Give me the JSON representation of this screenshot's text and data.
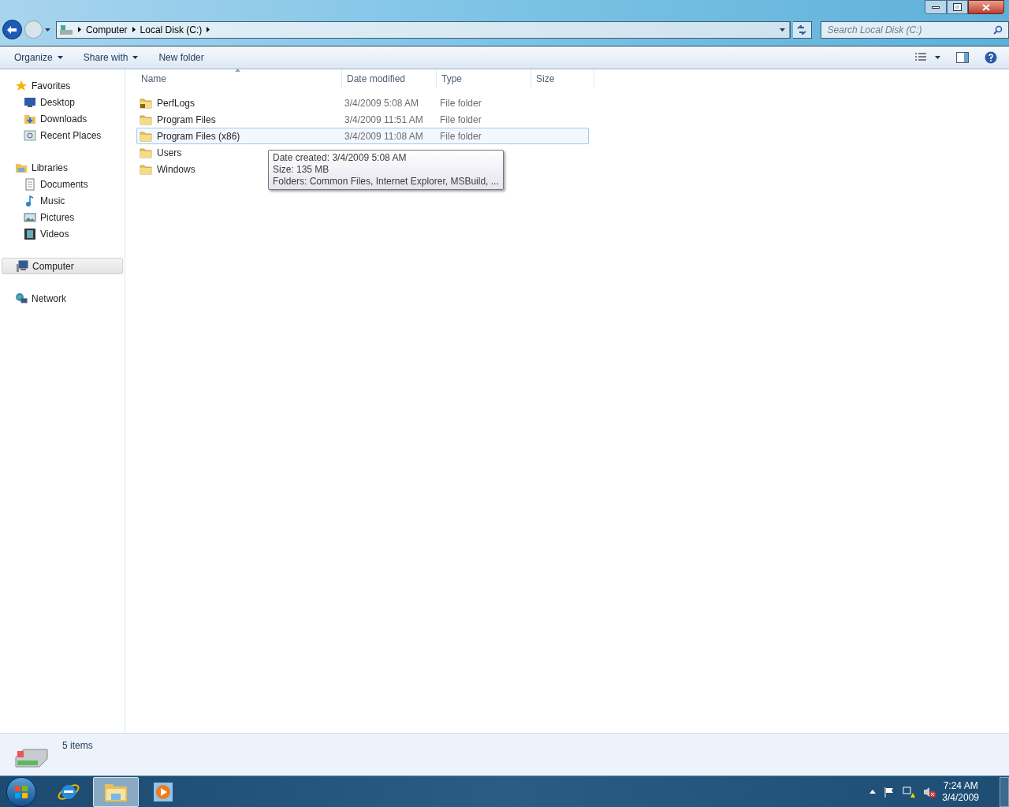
{
  "address_bar": {
    "segments": [
      "Computer",
      "Local Disk (C:)"
    ]
  },
  "search": {
    "placeholder": "Search Local Disk (C:)"
  },
  "toolbar": {
    "items": [
      {
        "label": "Organize",
        "dropdown": true
      },
      {
        "label": "Share with",
        "dropdown": true
      },
      {
        "label": "New folder",
        "dropdown": false
      }
    ]
  },
  "sidebar": {
    "groups": [
      {
        "label": "Favorites",
        "selected": false,
        "children": [
          {
            "label": "Desktop"
          },
          {
            "label": "Downloads"
          },
          {
            "label": "Recent Places"
          }
        ]
      },
      {
        "label": "Libraries",
        "selected": false,
        "children": [
          {
            "label": "Documents"
          },
          {
            "label": "Music"
          },
          {
            "label": "Pictures"
          },
          {
            "label": "Videos"
          }
        ]
      },
      {
        "label": "Computer",
        "selected": true
      },
      {
        "label": "Network",
        "selected": false
      }
    ]
  },
  "table": {
    "columns": [
      "Name",
      "Date modified",
      "Type",
      "Size"
    ],
    "rows": [
      {
        "name": "PerfLogs",
        "date": "3/4/2009 5:08 AM",
        "type": "File folder",
        "locked": true,
        "selected": false
      },
      {
        "name": "Program Files",
        "date": "3/4/2009 11:51 AM",
        "type": "File folder",
        "locked": false,
        "selected": false
      },
      {
        "name": "Program Files (x86)",
        "date": "3/4/2009 11:08 AM",
        "type": "File folder",
        "locked": false,
        "selected": true
      },
      {
        "name": "Users",
        "locked": false,
        "selected": false
      },
      {
        "name": "Windows",
        "locked": false,
        "selected": false
      }
    ]
  },
  "tooltip": {
    "lines": [
      "Date created: 3/4/2009 5:08 AM",
      "Size: 135 MB",
      "Folders: Common Files, Internet Explorer, MSBuild, ..."
    ]
  },
  "status_bar": {
    "text": "5 items"
  },
  "taskbar": {
    "items": [
      {
        "kind": "browser",
        "selected": false
      },
      {
        "kind": "explorer",
        "selected": true
      },
      {
        "kind": "media",
        "selected": false
      }
    ],
    "time": "7:24 AM",
    "date": "3/4/2009"
  }
}
